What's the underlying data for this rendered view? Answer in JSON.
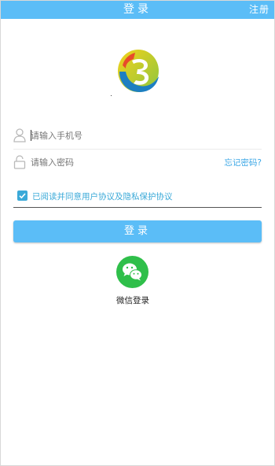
{
  "header": {
    "title": "登录",
    "register_label": "注册"
  },
  "logo": {
    "icon": "app-logo-icon"
  },
  "form": {
    "phone": {
      "placeholder": "请输入手机号",
      "value": "",
      "icon": "user-icon"
    },
    "password": {
      "placeholder": "请输入密码",
      "value": "",
      "icon": "lock-icon"
    },
    "forgot_label": "忘记密码?",
    "agreement": {
      "checked": true,
      "label": "已阅读并同意用户协议及隐私保护协议"
    },
    "login_label": "登录"
  },
  "social": {
    "wechat_label": "微信登录",
    "icon": "wechat-icon"
  },
  "colors": {
    "primary": "#5bbdf7",
    "link": "#3ba7e6",
    "checkbox": "#3aa9d8",
    "wechat": "#2fbf4a"
  }
}
